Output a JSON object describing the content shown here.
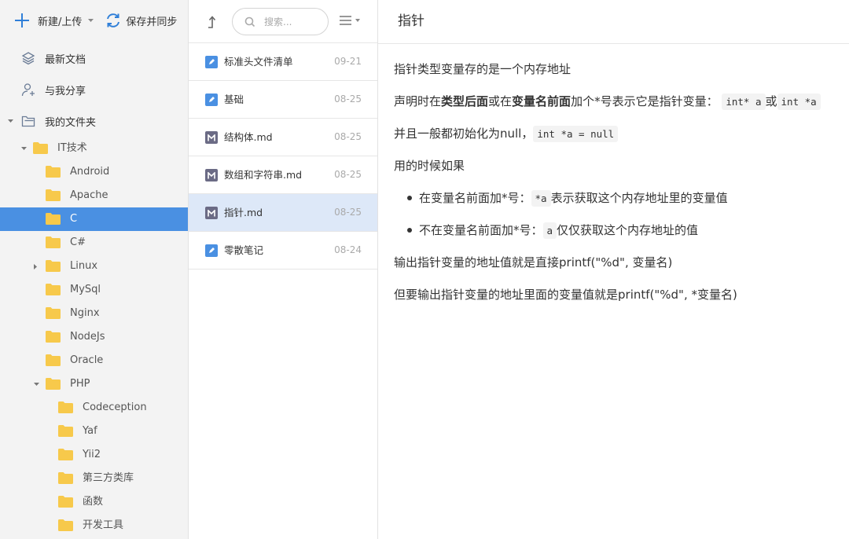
{
  "toolbar": {
    "new_label": "新建/上传",
    "sync_label": "保存并同步"
  },
  "nav": {
    "recent": "最新文档",
    "shared": "与我分享",
    "myfolder": "我的文件夹"
  },
  "tree": {
    "it": "IT技术",
    "android": "Android",
    "apache": "Apache",
    "c": "C",
    "csharp": "C#",
    "linux": "Linux",
    "mysql": "MySql",
    "nginx": "Nginx",
    "nodejs": "NodeJs",
    "oracle": "Oracle",
    "php": "PHP",
    "codeception": "Codeception",
    "yaf": "Yaf",
    "yii2": "Yii2",
    "thirdparty": "第三方类库",
    "functions": "函数",
    "devtools": "开发工具"
  },
  "search": {
    "placeholder": "搜索..."
  },
  "notes": [
    {
      "title": "标准头文件清单",
      "date": "09-21",
      "type": "note"
    },
    {
      "title": "基础",
      "date": "08-25",
      "type": "note"
    },
    {
      "title": "结构体.md",
      "date": "08-25",
      "type": "markdown"
    },
    {
      "title": "数组和字符串.md",
      "date": "08-25",
      "type": "markdown"
    },
    {
      "title": "指针.md",
      "date": "08-25",
      "type": "markdown"
    },
    {
      "title": "零散笔记",
      "date": "08-24",
      "type": "note"
    }
  ],
  "editor": {
    "title": "指针",
    "p1": "指针类型变量存的是一个内存地址",
    "p2": {
      "a": "声明时在",
      "b": "类型后面",
      "c": "或在",
      "d": "变量名前面",
      "e": "加个*号表示它是指针变量：",
      "code1": "int* a",
      "f": "或",
      "code2": "int *a"
    },
    "p3": {
      "a": "并且一般都初始化为null，",
      "code": "int *a = null"
    },
    "p4": "用的时候如果",
    "li1": {
      "a": "在变量名前面加*号：",
      "code": "*a",
      "b": "表示获取这个内存地址里的变量值"
    },
    "li2": {
      "a": "不在变量名前面加*号：",
      "code": "a",
      "b": "仅仅获取这个内存地址的值"
    },
    "p5": "输出指针变量的地址值就是直接printf(\"%d\", 变量名)",
    "p6": "但要输出指针变量的地址里面的变量值就是printf(\"%d\", *变量名)"
  },
  "colors": {
    "accent": "#4a90e2",
    "selected_note": "#dde8f8",
    "folder": "#f7c94b",
    "markdown_icon": "#6b6b85"
  }
}
